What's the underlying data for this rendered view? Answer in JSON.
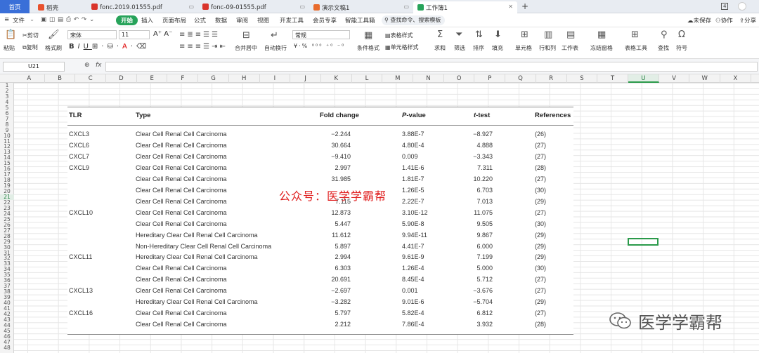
{
  "tabs": {
    "home": "首页",
    "items": [
      {
        "label": "稻壳",
        "color": "#e8502c"
      },
      {
        "label": "fonc.2019.01555.pdf",
        "color": "#d9342b"
      },
      {
        "label": "fonc-09-01555.pdf",
        "color": "#d9342b"
      },
      {
        "label": "演示文稿1",
        "color": "#e86b2c"
      },
      {
        "label": "工作簿1",
        "color": "#27a35a"
      }
    ],
    "page_num": "4"
  },
  "menu": {
    "file": "文件",
    "start": "开始",
    "items": [
      "插入",
      "页面布局",
      "公式",
      "数据",
      "审阅",
      "视图",
      "开发工具",
      "会员专享",
      "智能工具箱"
    ],
    "search": "查找命令、搜索模板",
    "unsaved": "未保存",
    "collab": "协作",
    "share": "分享"
  },
  "ribbon": {
    "paste": "粘贴",
    "cut": "剪切",
    "copy": "复制",
    "format_painter": "格式刷",
    "font": "宋体",
    "size": "11",
    "merge": "合并居中",
    "wrap": "自动换行",
    "numfmt": "常规",
    "cond_fmt": "条件格式",
    "table_style": "表格样式",
    "cell_style": "单元格样式",
    "sum": "求和",
    "filter": "筛选",
    "sort": "排序",
    "fill": "填充",
    "cell": "单元格",
    "rowcol": "行和列",
    "worksheet": "工作表",
    "freeze": "冻结窗格",
    "table_tools": "表格工具",
    "find": "查找",
    "symbol": "符号"
  },
  "formula_bar": {
    "name_box": "U21",
    "fx": "fx"
  },
  "columns": [
    "A",
    "B",
    "C",
    "D",
    "E",
    "F",
    "G",
    "H",
    "I",
    "J",
    "K",
    "L",
    "M",
    "N",
    "O",
    "P",
    "Q",
    "R",
    "S",
    "T",
    "U",
    "V",
    "W",
    "X"
  ],
  "selected_col": "U",
  "selected_row": "21",
  "table": {
    "headers": {
      "tlr": "TLR",
      "type": "Type",
      "fold": "Fold change",
      "p_italic": "P",
      "p_rest": "-value",
      "t_italic": "t",
      "t_rest": "-test",
      "ref": "References"
    },
    "rows": [
      {
        "tlr": "CXCL3",
        "type": "Clear Cell Renal Cell Carcinoma",
        "fold": "−2.244",
        "p": "3.88E-7",
        "t": "−8.927",
        "ref": "(26)"
      },
      {
        "tlr": "CXCL6",
        "type": "Clear Cell Renal Cell Carcinoma",
        "fold": "30.664",
        "p": "4.80E-4",
        "t": "4.888",
        "ref": "(27)"
      },
      {
        "tlr": "CXCL7",
        "type": "Clear Cell Renal Cell Carcinoma",
        "fold": "−9.410",
        "p": "0.009",
        "t": "−3.343",
        "ref": "(27)"
      },
      {
        "tlr": "CXCL9",
        "type": "Clear Cell Renal Cell Carcinoma",
        "fold": "2.997",
        "p": "1.41E-6",
        "t": "7.311",
        "ref": "(28)"
      },
      {
        "tlr": "",
        "type": "Clear Cell Renal Cell Carcinoma",
        "fold": "31.985",
        "p": "1.81E-7",
        "t": "10.220",
        "ref": "(27)"
      },
      {
        "tlr": "",
        "type": "Clear Cell Renal Cell Carcinoma",
        "fold": "",
        "p": "1.26E-5",
        "t": "6.703",
        "ref": "(30)"
      },
      {
        "tlr": "",
        "type": "Clear Cell Renal Cell Carcinoma",
        "fold": "7.115",
        "p": "2.22E-7",
        "t": "7.013",
        "ref": "(29)"
      },
      {
        "tlr": "CXCL10",
        "type": "Clear Cell Renal Cell Carcinoma",
        "fold": "12.873",
        "p": "3.10E-12",
        "t": "11.075",
        "ref": "(27)"
      },
      {
        "tlr": "",
        "type": "Clear Cell Renal Cell Carcinoma",
        "fold": "5.447",
        "p": "5.90E-8",
        "t": "9.505",
        "ref": "(30)"
      },
      {
        "tlr": "",
        "type": "Hereditary Clear Cell Renal Cell Carcinoma",
        "fold": "11.612",
        "p": "9.94E-11",
        "t": "9.867",
        "ref": "(29)"
      },
      {
        "tlr": "",
        "type": "Non-Hereditary Clear Cell Renal Cell Carcinoma",
        "fold": "5.897",
        "p": "4.41E-7",
        "t": "6.000",
        "ref": "(29)"
      },
      {
        "tlr": "CXCL11",
        "type": "Hereditary Clear Cell Renal Cell Carcinoma",
        "fold": "2.994",
        "p": "9.61E-9",
        "t": "7.199",
        "ref": "(29)"
      },
      {
        "tlr": "",
        "type": "Clear Cell Renal Cell Carcinoma",
        "fold": "6.303",
        "p": "1.26E-4",
        "t": "5.000",
        "ref": "(30)"
      },
      {
        "tlr": "",
        "type": "Clear Cell Renal Cell Carcinoma",
        "fold": "20.691",
        "p": "8.45E-4",
        "t": "5.712",
        "ref": "(27)"
      },
      {
        "tlr": "CXCL13",
        "type": "Clear Cell Renal Cell Carcinoma",
        "fold": "−2.697",
        "p": "0.001",
        "t": "−3.676",
        "ref": "(27)"
      },
      {
        "tlr": "",
        "type": "Hereditary Clear Cell Renal Cell Carcinoma",
        "fold": "−3.282",
        "p": "9.01E-6",
        "t": "−5.704",
        "ref": "(29)"
      },
      {
        "tlr": "CXCL16",
        "type": "Clear Cell Renal Cell Carcinoma",
        "fold": "5.797",
        "p": "5.82E-4",
        "t": "6.812",
        "ref": "(27)"
      },
      {
        "tlr": "",
        "type": "Clear Cell Renal Cell Carcinoma",
        "fold": "2.212",
        "p": "7.86E-4",
        "t": "3.932",
        "ref": "(28)"
      }
    ]
  },
  "watermark_center": "公众号：医学学霸帮",
  "watermark_corner": "医学学霸帮"
}
